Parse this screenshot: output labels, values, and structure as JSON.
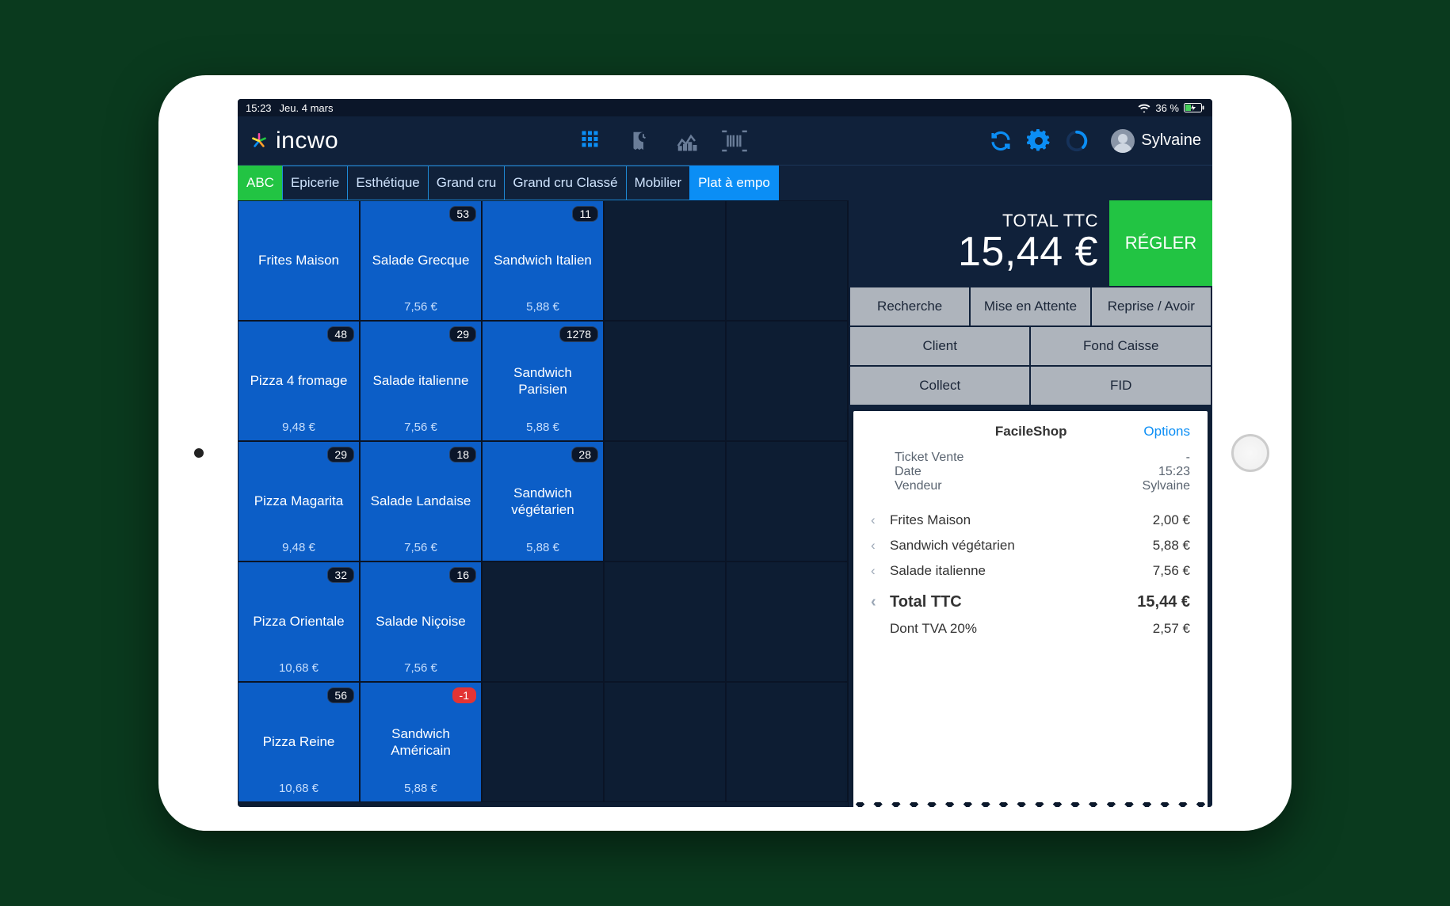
{
  "status": {
    "time": "15:23",
    "date": "Jeu. 4 mars",
    "battery": "36 %"
  },
  "brand": "incwo",
  "user": "Sylvaine",
  "categories": [
    {
      "label": "ABC",
      "kind": "abc"
    },
    {
      "label": "Epicerie"
    },
    {
      "label": "Esthétique"
    },
    {
      "label": "Grand cru"
    },
    {
      "label": "Grand cru Classé"
    },
    {
      "label": "Mobilier"
    },
    {
      "label": "Plat à empo",
      "kind": "active"
    }
  ],
  "grid": [
    [
      {
        "name": "Frites Maison",
        "price": "",
        "badge": ""
      },
      {
        "name": "Salade Grecque",
        "price": "7,56 €",
        "badge": "53"
      },
      {
        "name": "Sandwich Italien",
        "price": "5,88 €",
        "badge": "11"
      },
      null,
      null
    ],
    [
      {
        "name": "Pizza 4 fromage",
        "price": "9,48 €",
        "badge": "48"
      },
      {
        "name": "Salade italienne",
        "price": "7,56 €",
        "badge": "29"
      },
      {
        "name": "Sandwich Parisien",
        "price": "5,88 €",
        "badge": "1278"
      },
      null,
      null
    ],
    [
      {
        "name": "Pizza Magarita",
        "price": "9,48 €",
        "badge": "29"
      },
      {
        "name": "Salade Landaise",
        "price": "7,56 €",
        "badge": "18"
      },
      {
        "name": "Sandwich végétarien",
        "price": "5,88 €",
        "badge": "28"
      },
      null,
      null
    ],
    [
      {
        "name": "Pizza Orientale",
        "price": "10,68 €",
        "badge": "32"
      },
      {
        "name": "Salade Niçoise",
        "price": "7,56 €",
        "badge": "16"
      },
      null,
      null,
      null
    ],
    [
      {
        "name": "Pizza Reine",
        "price": "10,68 €",
        "badge": "56"
      },
      {
        "name": "Sandwich Américain",
        "price": "5,88 €",
        "badge": "-1",
        "neg": true
      },
      null,
      null,
      null
    ]
  ],
  "total": {
    "label": "TOTAL TTC",
    "value": "15,44 €"
  },
  "pay_label": "RÉGLER",
  "actions": {
    "search": "Recherche",
    "hold": "Mise en Attente",
    "return": "Reprise / Avoir",
    "client": "Client",
    "cash": "Fond Caisse",
    "collect": "Collect",
    "fid": "FID"
  },
  "receipt": {
    "shop": "FacileShop",
    "options": "Options",
    "meta": {
      "ticket_label": "Ticket Vente",
      "ticket_val": "-",
      "date_label": "Date",
      "date_val": "15:23",
      "seller_label": "Vendeur",
      "seller_val": "Sylvaine"
    },
    "lines": [
      {
        "name": "Frites Maison",
        "price": "2,00 €"
      },
      {
        "name": "Sandwich végétarien",
        "price": "5,88 €"
      },
      {
        "name": "Salade italienne",
        "price": "7,56 €"
      }
    ],
    "total_label": "Total TTC",
    "total_value": "15,44 €",
    "tax_label": "Dont TVA 20%",
    "tax_value": "2,57 €"
  }
}
